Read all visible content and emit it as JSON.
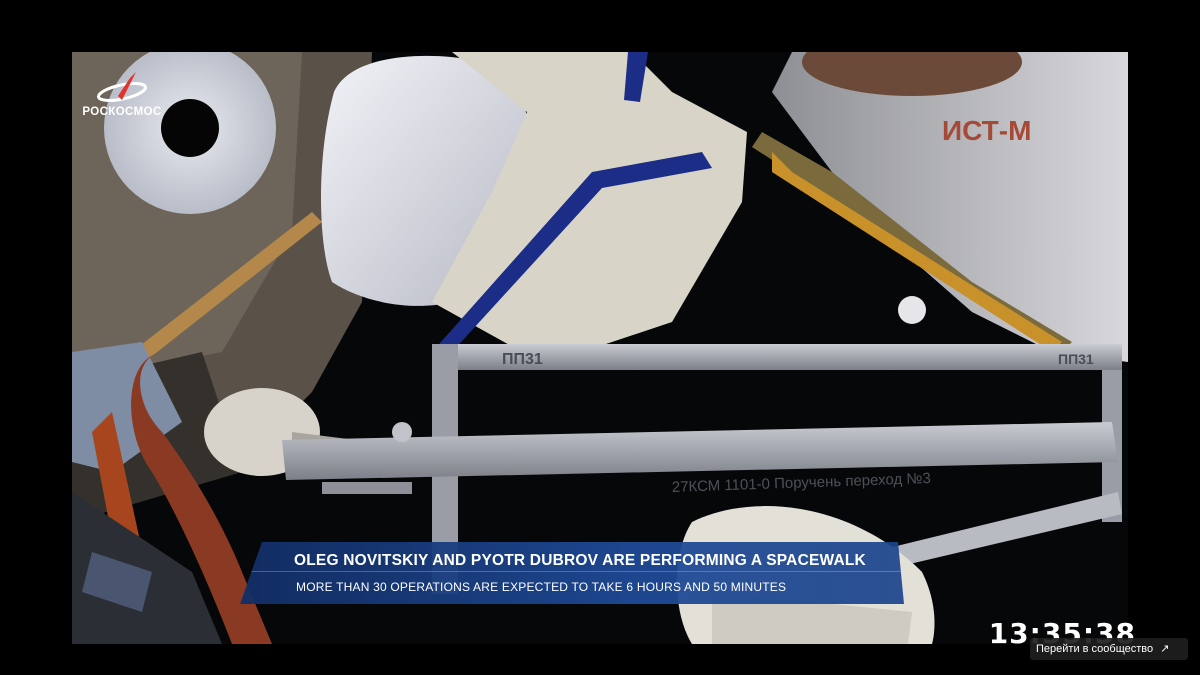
{
  "broadcast": {
    "logo_text": "РОСКОСМОС",
    "headline": "OLEG NOVITSKIY AND PYOTR DUBROV ARE PERFORMING A SPACEWALK",
    "subline": "MORE THAN 30 OPERATIONS ARE EXPECTED TO TAKE 6 HOURS AND 50 MINUTES",
    "clock": "13:35:38"
  },
  "overlay": {
    "community_link_label": "Перейти в сообщество",
    "community_link_icon": "arrow-up-right-icon"
  },
  "colors": {
    "banner_blue": "#1e4a96",
    "logo_red": "#e0332b",
    "background": "#000000"
  }
}
